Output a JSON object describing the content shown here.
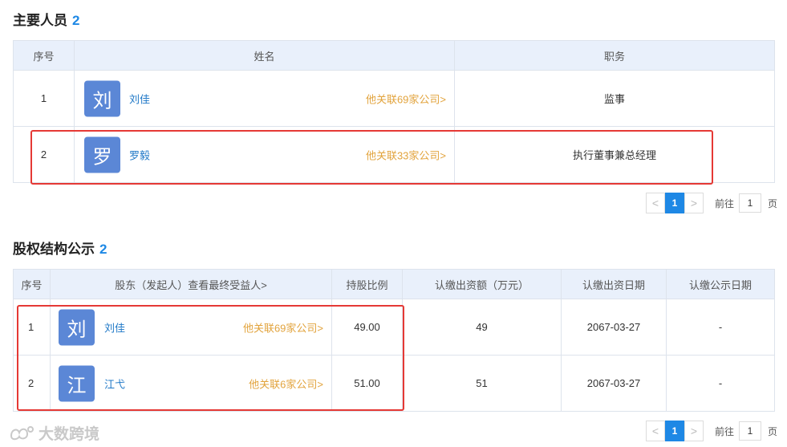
{
  "personnel": {
    "title": "主要人员",
    "count": "2",
    "headers": [
      "序号",
      "姓名",
      "职务"
    ],
    "rows": [
      {
        "index": "1",
        "avatar": "刘",
        "name": "刘佳",
        "related": "他关联69家公司>",
        "position": "监事"
      },
      {
        "index": "2",
        "avatar": "罗",
        "name": "罗毅",
        "related": "他关联33家公司>",
        "position": "执行董事兼总经理"
      }
    ]
  },
  "shareholders": {
    "title": "股权结构公示",
    "count": "2",
    "headers": [
      "序号",
      "股东（发起人）查看最终受益人>",
      "持股比例",
      "认缴出资额（万元）",
      "认缴出资日期",
      "认缴公示日期"
    ],
    "rows": [
      {
        "index": "1",
        "avatar": "刘",
        "name": "刘佳",
        "related": "他关联69家公司>",
        "ratio": "49.00",
        "amount": "49",
        "date": "2067-03-27",
        "public_date": "-"
      },
      {
        "index": "2",
        "avatar": "江",
        "name": "江弋",
        "related": "他关联6家公司>",
        "ratio": "51.00",
        "amount": "51",
        "date": "2067-03-27",
        "public_date": "-"
      }
    ]
  },
  "pagination": {
    "prev": "<",
    "current": "1",
    "next": ">",
    "goto_label": "前往",
    "page_value": "1",
    "suffix": "页"
  },
  "watermark": {
    "text": "大数跨境",
    "icon": "logo-icon"
  }
}
